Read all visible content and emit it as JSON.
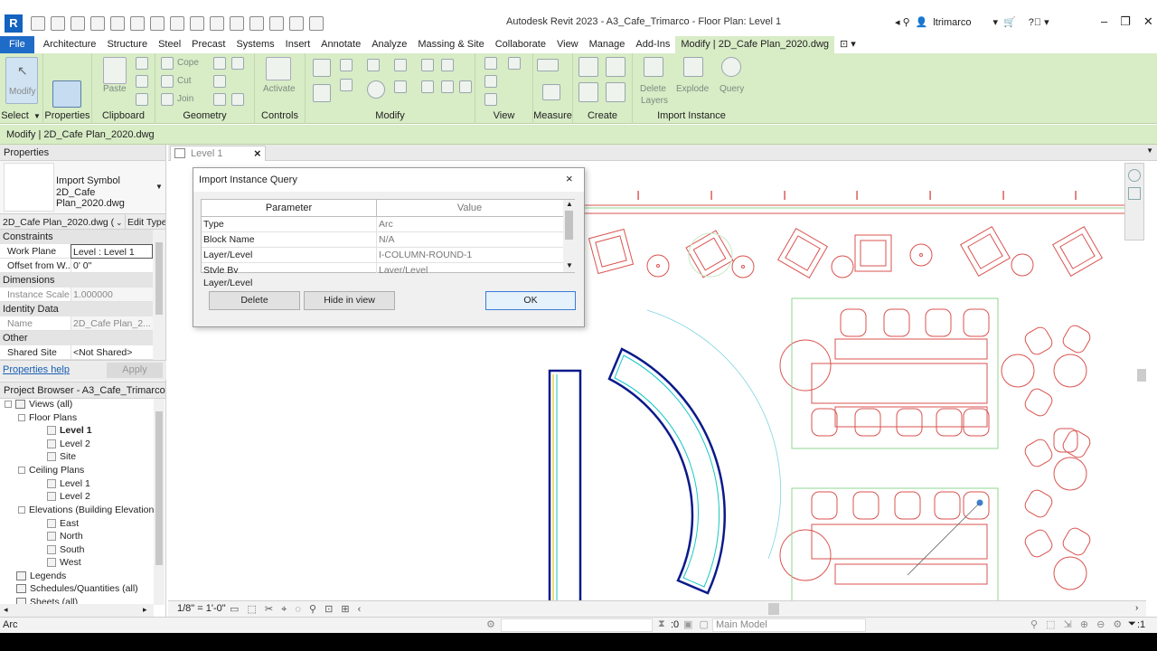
{
  "app": {
    "title": "Autodesk Revit 2023 - A3_Cafe_Trimarco - Floor Plan: Level 1",
    "user": "ltrimarco",
    "logo": "R"
  },
  "menu": {
    "file": "File",
    "items": [
      "Architecture",
      "Structure",
      "Steel",
      "Precast",
      "Systems",
      "Insert",
      "Annotate",
      "Analyze",
      "Massing & Site",
      "Collaborate",
      "View",
      "Manage",
      "Add-Ins",
      "Modify | 2D_Cafe Plan_2020.dwg"
    ]
  },
  "ribbon": {
    "modify_label": "Modify",
    "select_label": "Select",
    "properties_label": "Properties",
    "clipboard_label": "Clipboard",
    "paste_label": "Paste",
    "cope_label": "Cope",
    "cut_label": "Cut",
    "join_label": "Join",
    "geometry_label": "Geometry",
    "activate_label": "Activate",
    "controls_label": "Controls",
    "modify_group_label": "Modify",
    "view_label": "View",
    "measure_label": "Measure",
    "create_label": "Create",
    "delete_layers_label1": "Delete",
    "delete_layers_label2": "Layers",
    "explode_label": "Explode",
    "query_label": "Query",
    "import_instance_label": "Import Instance"
  },
  "context_bar": "Modify | 2D_Cafe Plan_2020.dwg",
  "properties": {
    "header": "Properties",
    "type_line1": "Import Symbol",
    "type_line2": "2D_Cafe Plan_2020.dwg",
    "selector": "2D_Cafe Plan_2020.dwg (",
    "edit_type": "Edit Type",
    "sections": {
      "constraints": "Constraints",
      "dimensions": "Dimensions",
      "identity": "Identity Data",
      "other": "Other"
    },
    "rows": {
      "work_plane": {
        "name": "Work Plane",
        "value": "Level : Level 1"
      },
      "offset": {
        "name": "Offset from W...",
        "value": "0'  0\""
      },
      "instance_scale": {
        "name": "Instance Scale",
        "value": "1.000000"
      },
      "name": {
        "name": "Name",
        "value": "2D_Cafe Plan_2..."
      },
      "shared_site": {
        "name": "Shared Site",
        "value": "<Not Shared>"
      }
    },
    "help_link": "Properties help",
    "apply": "Apply"
  },
  "browser": {
    "header": "Project Browser - A3_Cafe_Trimarco",
    "views": "Views (all)",
    "floor_plans": "Floor Plans",
    "fp_level1": "Level 1",
    "fp_level2": "Level 2",
    "fp_site": "Site",
    "ceiling_plans": "Ceiling Plans",
    "cp_level1": "Level 1",
    "cp_level2": "Level 2",
    "elevations": "Elevations (Building Elevation)",
    "east": "East",
    "north": "North",
    "south": "South",
    "west": "West",
    "legends": "Legends",
    "schedules": "Schedules/Quantities (all)",
    "sheets": "Sheets (all)"
  },
  "view_tab": {
    "label": "Level 1",
    "close": "×"
  },
  "view_control": {
    "scale": "1/8\" = 1'-0\""
  },
  "status": {
    "left": "Arc",
    "count": ":0",
    "model": "Main Model",
    "filter": ":1"
  },
  "dialog": {
    "title": "Import Instance Query",
    "col_parameter": "Parameter",
    "col_value": "Value",
    "rows": [
      {
        "param": "Type",
        "value": "Arc"
      },
      {
        "param": "Block Name",
        "value": "N/A"
      },
      {
        "param": "Layer/Level",
        "value": "I-COLUMN-ROUND-1"
      },
      {
        "param": "Style By",
        "value": "Layer/Level"
      }
    ],
    "desc": "Layer/Level",
    "delete_btn": "Delete",
    "hide_btn": "Hide in view",
    "ok_btn": "OK",
    "close": "×"
  },
  "colors": {
    "ribbon": "#d8ecc6",
    "file_tab": "#1f6bc8",
    "cad_red": "#d9534f",
    "cad_green": "#90d690",
    "wall_blue": "#0a1a8a",
    "wall_cyan": "#18c6c6"
  }
}
